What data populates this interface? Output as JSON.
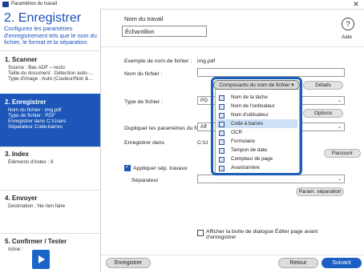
{
  "window": {
    "title": "Paramètres du travail",
    "close": "✕"
  },
  "step": {
    "title": "2. Enregistrer",
    "desc_lines": [
      "Configurez les paramètres",
      "d'enregistrement tels que le nom du",
      "fichier, le format et la séparation."
    ]
  },
  "nav": {
    "scanner": {
      "title": "1. Scanner",
      "lines": [
        "Source : Bac ADF – recto",
        "Taille du document : Détection auto-…",
        "Type d'image : Auto (Couleur/Noir &…"
      ]
    },
    "enregistrer": {
      "title": "2. Enregistrer",
      "lines": [
        "Nom du fichier : img.pdf",
        "Type de fichier : PDF",
        "Enregistrer dans C:\\Users",
        "Séparateur Code-barres"
      ]
    },
    "index": {
      "title": "3. Index",
      "lines": [
        "Éléments d'index : 6"
      ]
    },
    "envoyer": {
      "title": "4. Envoyer",
      "lines": [
        "Destination : Ne rien faire"
      ]
    },
    "confirmer": {
      "title": "5. Confirmer / Tester",
      "lines": [
        "Icône :"
      ]
    }
  },
  "header": {
    "jobname_label": "Nom du travail",
    "jobname_value": "Échantillon",
    "help_icon": "?",
    "help_label": "Aide"
  },
  "form": {
    "example_label": "Exemple de nom de fichier :",
    "example_value": "img.pdf",
    "filename_label": "Nom du fichier :",
    "components_button": "Composants du nom de fichier ▾",
    "details_button": "Détails",
    "filetype_label": "Type de fichier :",
    "filetype_value": "PD",
    "options_button": "Options",
    "duplicate_label": "Dupliquer les paramètres du fi",
    "duplicate_value": "Aff",
    "savein_label": "Enregistrer dans",
    "savein_value": "C:\\U",
    "browse_button": "Parcourir",
    "apply_sep_label": "Appliquer sép. travaux",
    "separator_label": "Séparateur",
    "sep_params_button": "Param. séparation",
    "show_dialog_line1": "Afficher la boîte de dialogue Éditer page avant",
    "show_dialog_line2": "d'enregistrer"
  },
  "menu": {
    "items": [
      "Nom de la tâche",
      "Nom de l'ordinateur",
      "Nom d'utilisateur",
      "Code à barres",
      "OCR",
      "Formulaire",
      "Tampon de date",
      "Compteur de page",
      "Avant/arrière"
    ],
    "selected": "Code à barres"
  },
  "footer": {
    "save": "Enregistrer",
    "back": "Retour",
    "next": "Suivant"
  },
  "colors": {
    "accent": "#1b56b8",
    "next": "#1c5fc4"
  }
}
